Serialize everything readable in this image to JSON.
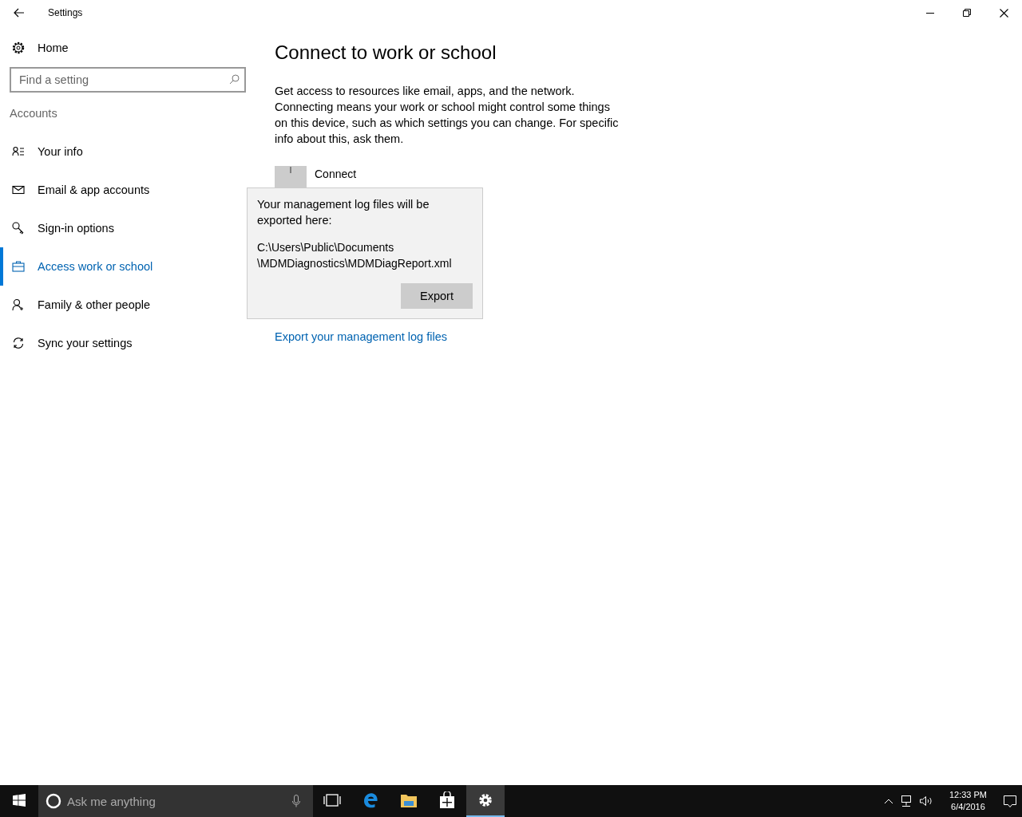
{
  "window": {
    "title": "Settings"
  },
  "sidebar": {
    "home": "Home",
    "search": {
      "placeholder": "Find a setting"
    },
    "section": "Accounts",
    "items": [
      {
        "label": "Your info",
        "kind": "info",
        "selected": false
      },
      {
        "label": "Email & app accounts",
        "kind": "email",
        "selected": false
      },
      {
        "label": "Sign-in options",
        "kind": "signin",
        "selected": false
      },
      {
        "label": "Access work or school",
        "kind": "work",
        "selected": true
      },
      {
        "label": "Family & other people",
        "kind": "family",
        "selected": false
      },
      {
        "label": "Sync your settings",
        "kind": "sync",
        "selected": false
      }
    ]
  },
  "content": {
    "title": "Connect to work or school",
    "description": "Get access to resources like email, apps, and the network. Connecting means your work or school might control some things on this device, such as which settings you can change. For specific info about this, ask them.",
    "connect": "Connect",
    "export_link": "Export your management log files"
  },
  "popup": {
    "message": "Your management log files will be exported here:",
    "path": "C:\\Users\\Public\\Documents\n\\MDMDiagnostics\\MDMDiagReport.xml",
    "button": "Export"
  },
  "taskbar": {
    "search": {
      "placeholder": "Ask me anything"
    },
    "apps": [
      {
        "kind": "taskview",
        "selected": false
      },
      {
        "kind": "browser",
        "selected": false
      },
      {
        "kind": "files",
        "selected": false
      },
      {
        "kind": "store",
        "selected": false
      },
      {
        "kind": "settings",
        "selected": true
      }
    ],
    "time": "12:33 PM",
    "date": "6/4/2016"
  }
}
